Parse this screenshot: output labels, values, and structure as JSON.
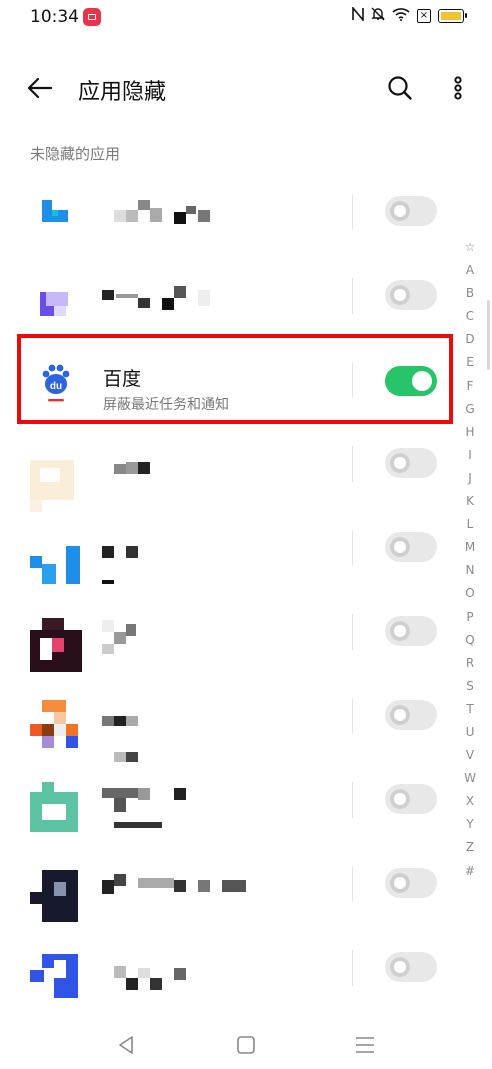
{
  "status_bar": {
    "time": "10:34"
  },
  "header": {
    "title": "应用隐藏"
  },
  "section": {
    "label": "未隐藏的应用"
  },
  "apps": [
    {
      "name": "",
      "subtitle": "",
      "hidden": false
    },
    {
      "name": "",
      "subtitle": "",
      "hidden": false
    },
    {
      "name": "百度",
      "subtitle": "屏蔽最近任务和通知",
      "hidden": true
    },
    {
      "name": "",
      "subtitle": "",
      "hidden": false
    },
    {
      "name": "",
      "subtitle": "",
      "hidden": false
    },
    {
      "name": "",
      "subtitle": "",
      "hidden": false
    },
    {
      "name": "",
      "subtitle": "",
      "hidden": false
    },
    {
      "name": "",
      "subtitle": "",
      "hidden": false
    },
    {
      "name": "",
      "subtitle": "",
      "hidden": false
    },
    {
      "name": "",
      "subtitle": "",
      "hidden": false
    }
  ],
  "alphabet_index": [
    "☆",
    "A",
    "B",
    "C",
    "D",
    "E",
    "F",
    "G",
    "H",
    "I",
    "J",
    "K",
    "L",
    "M",
    "N",
    "O",
    "P",
    "Q",
    "R",
    "S",
    "T",
    "U",
    "V",
    "W",
    "X",
    "Y",
    "Z",
    "#"
  ],
  "colors": {
    "toggle_on": "#27c46a",
    "highlight": "#ee0a0a",
    "baidu_blue": "#2d62e0",
    "baidu_red": "#e5302e"
  }
}
